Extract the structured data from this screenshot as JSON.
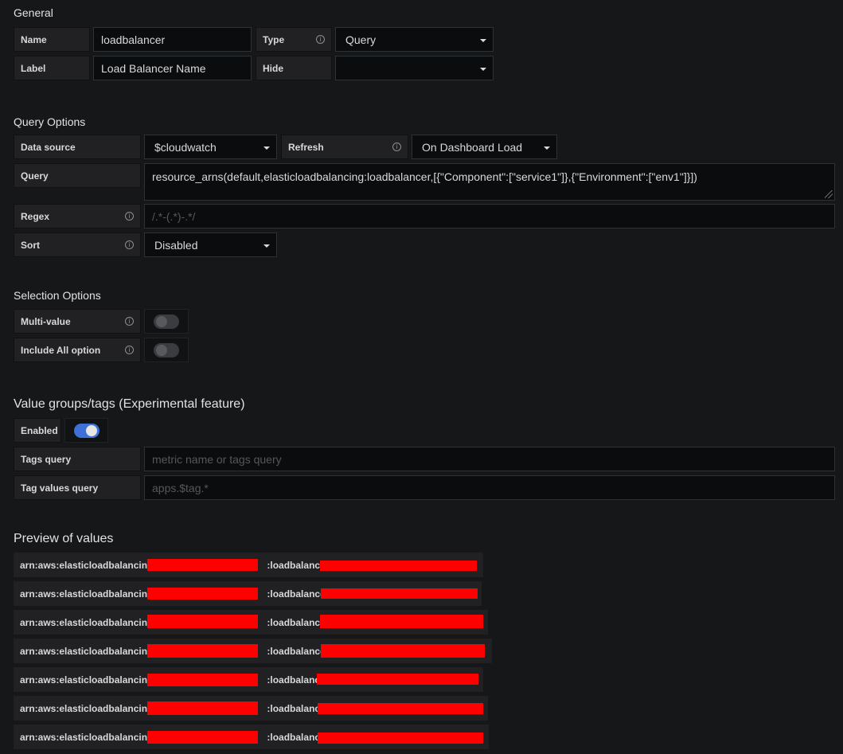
{
  "general": {
    "title": "General",
    "name_label": "Name",
    "name_value": "loadbalancer",
    "type_label": "Type",
    "type_value": "Query",
    "label_label": "Label",
    "label_value": "Load Balancer Name",
    "hide_label": "Hide",
    "hide_value": ""
  },
  "query_options": {
    "title": "Query Options",
    "datasource_label": "Data source",
    "datasource_value": "$cloudwatch",
    "refresh_label": "Refresh",
    "refresh_value": "On Dashboard Load",
    "query_label": "Query",
    "query_value": "resource_arns(default,elasticloadbalancing:loadbalancer,[{\"Component\":[\"service1\"]},{\"Environment\":[\"env1\"]}])",
    "regex_label": "Regex",
    "regex_placeholder": "/.*-(.*)-.*/",
    "sort_label": "Sort",
    "sort_value": "Disabled"
  },
  "selection_options": {
    "title": "Selection Options",
    "multivalue_label": "Multi-value",
    "multivalue_on": false,
    "include_all_label": "Include All option",
    "include_all_on": false
  },
  "value_groups": {
    "title": "Value groups/tags (Experimental feature)",
    "enabled_label": "Enabled",
    "enabled_on": true,
    "tags_query_label": "Tags query",
    "tags_query_placeholder": "metric name or tags query",
    "tag_values_label": "Tag values query",
    "tag_values_placeholder": "apps.$tag.*"
  },
  "preview": {
    "title": "Preview of values",
    "prefix": "arn:aws:elasticloadbalancing:",
    "middle": ":loadbalancer/",
    "items": [
      "",
      "",
      "",
      "",
      "",
      "",
      ""
    ]
  },
  "colors": {
    "background": "#161719",
    "label_bg": "#212124",
    "input_bg": "#0b0c0e",
    "toggle_on": "#3d71d9",
    "redaction": "#ff0000"
  }
}
